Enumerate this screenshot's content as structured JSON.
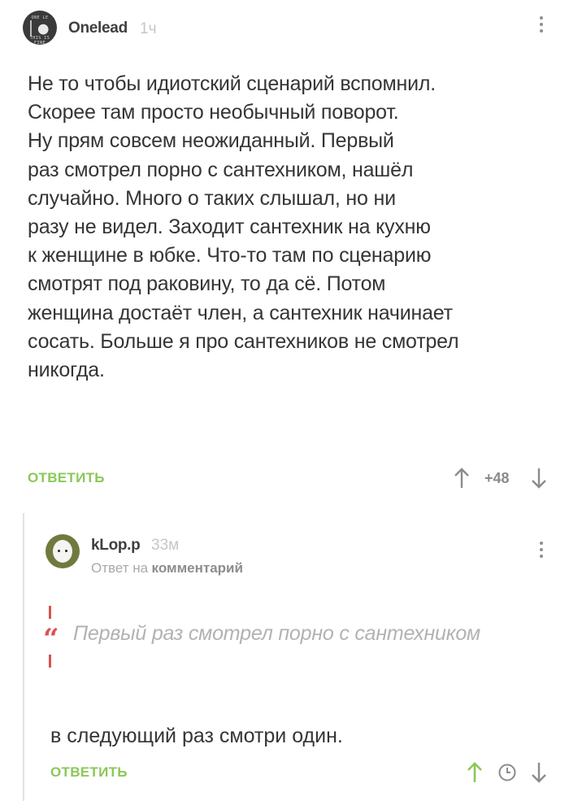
{
  "comment": {
    "author": "Onelead",
    "time": "1ч",
    "avatar_caption_top": "ONE LE",
    "avatar_caption_bottom": "THIS IS FINE",
    "body_lines": [
      "Не то чтобы идиотский сценарий вспомнил.",
      "Скорее там просто необычный поворот.",
      "Ну прям совсем неожиданный. Первый",
      "раз смотрел порно с сантехником, нашёл",
      "случайно. Много о таких слышал, но ни",
      "разу не видел. Заходит сантехник на кухню",
      "к женщине в юбке. Что-то там по сценарию",
      "смотрят под раковину, то да сё. Потом",
      "женщина достаёт член, а сантехник начинает",
      "сосать. Больше я про сантехников не смотрел",
      "никогда."
    ],
    "reply_label": "ОТВЕТИТЬ",
    "score": "+48",
    "icons": {
      "upvote": "arrow-up-icon",
      "downvote": "arrow-down-icon",
      "menu": "kebab-icon"
    }
  },
  "reply": {
    "author": "kLop.p",
    "time": "33м",
    "reply_to_prefix": "Ответ на",
    "reply_to_link": "комментарий",
    "quote_mark": "“",
    "quote": "Первый раз смотрел порно с сантехником",
    "body": "в следующий раз смотри один.",
    "reply_label": "ОТВЕТИТЬ",
    "icons": {
      "upvote": "arrow-up-icon",
      "save": "clock-icon",
      "downvote": "arrow-down-icon",
      "menu": "kebab-icon"
    }
  },
  "colors": {
    "accent_green": "#8ac858",
    "quote_red": "#d9534f",
    "text_main": "#353535",
    "text_muted": "#b2b2b2"
  }
}
